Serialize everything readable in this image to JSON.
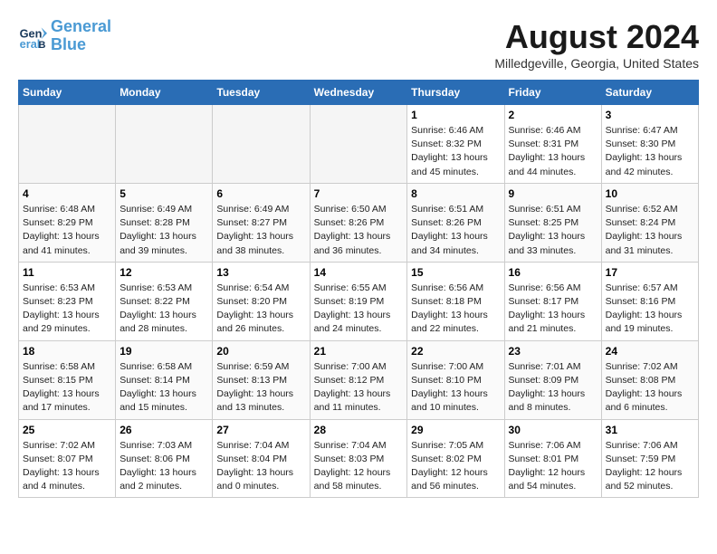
{
  "header": {
    "logo_line1": "General",
    "logo_line2": "Blue",
    "month_year": "August 2024",
    "location": "Milledgeville, Georgia, United States"
  },
  "weekdays": [
    "Sunday",
    "Monday",
    "Tuesday",
    "Wednesday",
    "Thursday",
    "Friday",
    "Saturday"
  ],
  "weeks": [
    [
      {
        "day": "",
        "info": ""
      },
      {
        "day": "",
        "info": ""
      },
      {
        "day": "",
        "info": ""
      },
      {
        "day": "",
        "info": ""
      },
      {
        "day": "1",
        "info": "Sunrise: 6:46 AM\nSunset: 8:32 PM\nDaylight: 13 hours\nand 45 minutes."
      },
      {
        "day": "2",
        "info": "Sunrise: 6:46 AM\nSunset: 8:31 PM\nDaylight: 13 hours\nand 44 minutes."
      },
      {
        "day": "3",
        "info": "Sunrise: 6:47 AM\nSunset: 8:30 PM\nDaylight: 13 hours\nand 42 minutes."
      }
    ],
    [
      {
        "day": "4",
        "info": "Sunrise: 6:48 AM\nSunset: 8:29 PM\nDaylight: 13 hours\nand 41 minutes."
      },
      {
        "day": "5",
        "info": "Sunrise: 6:49 AM\nSunset: 8:28 PM\nDaylight: 13 hours\nand 39 minutes."
      },
      {
        "day": "6",
        "info": "Sunrise: 6:49 AM\nSunset: 8:27 PM\nDaylight: 13 hours\nand 38 minutes."
      },
      {
        "day": "7",
        "info": "Sunrise: 6:50 AM\nSunset: 8:26 PM\nDaylight: 13 hours\nand 36 minutes."
      },
      {
        "day": "8",
        "info": "Sunrise: 6:51 AM\nSunset: 8:26 PM\nDaylight: 13 hours\nand 34 minutes."
      },
      {
        "day": "9",
        "info": "Sunrise: 6:51 AM\nSunset: 8:25 PM\nDaylight: 13 hours\nand 33 minutes."
      },
      {
        "day": "10",
        "info": "Sunrise: 6:52 AM\nSunset: 8:24 PM\nDaylight: 13 hours\nand 31 minutes."
      }
    ],
    [
      {
        "day": "11",
        "info": "Sunrise: 6:53 AM\nSunset: 8:23 PM\nDaylight: 13 hours\nand 29 minutes."
      },
      {
        "day": "12",
        "info": "Sunrise: 6:53 AM\nSunset: 8:22 PM\nDaylight: 13 hours\nand 28 minutes."
      },
      {
        "day": "13",
        "info": "Sunrise: 6:54 AM\nSunset: 8:20 PM\nDaylight: 13 hours\nand 26 minutes."
      },
      {
        "day": "14",
        "info": "Sunrise: 6:55 AM\nSunset: 8:19 PM\nDaylight: 13 hours\nand 24 minutes."
      },
      {
        "day": "15",
        "info": "Sunrise: 6:56 AM\nSunset: 8:18 PM\nDaylight: 13 hours\nand 22 minutes."
      },
      {
        "day": "16",
        "info": "Sunrise: 6:56 AM\nSunset: 8:17 PM\nDaylight: 13 hours\nand 21 minutes."
      },
      {
        "day": "17",
        "info": "Sunrise: 6:57 AM\nSunset: 8:16 PM\nDaylight: 13 hours\nand 19 minutes."
      }
    ],
    [
      {
        "day": "18",
        "info": "Sunrise: 6:58 AM\nSunset: 8:15 PM\nDaylight: 13 hours\nand 17 minutes."
      },
      {
        "day": "19",
        "info": "Sunrise: 6:58 AM\nSunset: 8:14 PM\nDaylight: 13 hours\nand 15 minutes."
      },
      {
        "day": "20",
        "info": "Sunrise: 6:59 AM\nSunset: 8:13 PM\nDaylight: 13 hours\nand 13 minutes."
      },
      {
        "day": "21",
        "info": "Sunrise: 7:00 AM\nSunset: 8:12 PM\nDaylight: 13 hours\nand 11 minutes."
      },
      {
        "day": "22",
        "info": "Sunrise: 7:00 AM\nSunset: 8:10 PM\nDaylight: 13 hours\nand 10 minutes."
      },
      {
        "day": "23",
        "info": "Sunrise: 7:01 AM\nSunset: 8:09 PM\nDaylight: 13 hours\nand 8 minutes."
      },
      {
        "day": "24",
        "info": "Sunrise: 7:02 AM\nSunset: 8:08 PM\nDaylight: 13 hours\nand 6 minutes."
      }
    ],
    [
      {
        "day": "25",
        "info": "Sunrise: 7:02 AM\nSunset: 8:07 PM\nDaylight: 13 hours\nand 4 minutes."
      },
      {
        "day": "26",
        "info": "Sunrise: 7:03 AM\nSunset: 8:06 PM\nDaylight: 13 hours\nand 2 minutes."
      },
      {
        "day": "27",
        "info": "Sunrise: 7:04 AM\nSunset: 8:04 PM\nDaylight: 13 hours\nand 0 minutes."
      },
      {
        "day": "28",
        "info": "Sunrise: 7:04 AM\nSunset: 8:03 PM\nDaylight: 12 hours\nand 58 minutes."
      },
      {
        "day": "29",
        "info": "Sunrise: 7:05 AM\nSunset: 8:02 PM\nDaylight: 12 hours\nand 56 minutes."
      },
      {
        "day": "30",
        "info": "Sunrise: 7:06 AM\nSunset: 8:01 PM\nDaylight: 12 hours\nand 54 minutes."
      },
      {
        "day": "31",
        "info": "Sunrise: 7:06 AM\nSunset: 7:59 PM\nDaylight: 12 hours\nand 52 minutes."
      }
    ]
  ]
}
